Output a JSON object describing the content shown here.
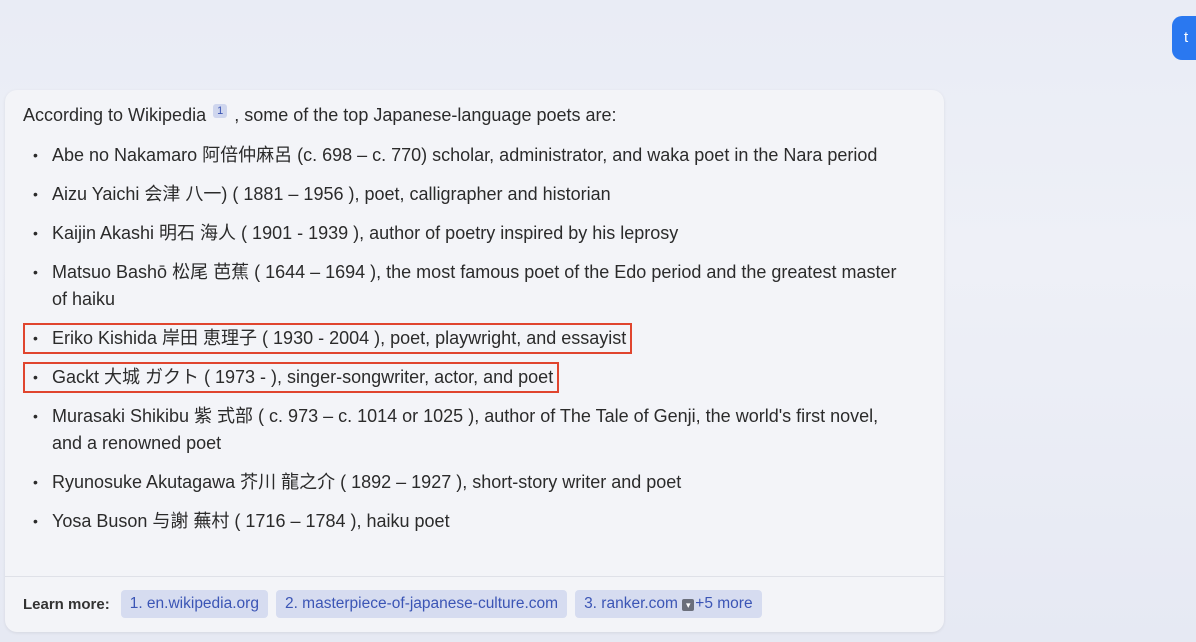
{
  "top_button_label": "t",
  "answer": {
    "intro_before": "According to Wikipedia",
    "ref_number": "1",
    "intro_after": ", some of the top Japanese-language poets are:",
    "poets": [
      "Abe no Nakamaro 阿倍仲麻呂 (c. 698 – c. 770) scholar, administrator, and waka poet in the Nara period",
      "Aizu Yaichi 会津 八一) ( 1881 – 1956 ), poet, calligrapher and historian",
      "Kaijin Akashi 明石 海人 ( 1901 - 1939 ), author of poetry inspired by his leprosy",
      "Matsuo Bashō 松尾 芭蕉 ( 1644 – 1694 ), the most famous poet of the Edo period and the greatest master of haiku",
      "Eriko Kishida 岸田 恵理子 ( 1930 - 2004 ), poet, playwright, and essayist",
      "Gackt 大城 ガクト ( 1973 - ), singer-songwriter, actor, and poet",
      "Murasaki Shikibu 紫 式部 ( c. 973 – c. 1014 or 1025 ), author of The Tale of Genji, the world's first novel, and a renowned poet",
      "Ryunosuke Akutagawa 芥川 龍之介 ( 1892 – 1927 ), short-story writer and poet",
      "Yosa Buson 与謝 蕪村 ( 1716 – 1784 ), haiku poet"
    ]
  },
  "learn_more": {
    "label": "Learn more:",
    "sources": [
      "1. en.wikipedia.org",
      "2. masterpiece-of-japanese-culture.com",
      "3. ranker.com"
    ],
    "more": "+5 more"
  },
  "colors": {
    "highlight_border": "#e0452e",
    "link": "#3b55b5",
    "chip_bg": "#d6dcf0"
  }
}
